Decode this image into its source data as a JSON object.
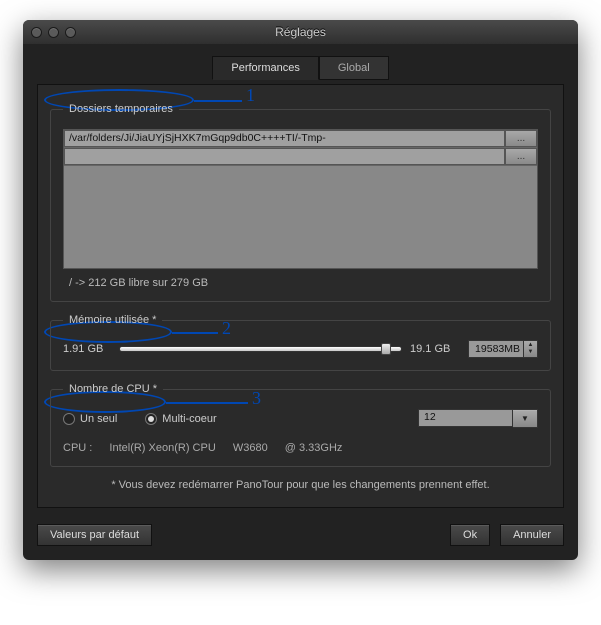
{
  "window": {
    "title": "Réglages"
  },
  "tabs": {
    "performances": "Performances",
    "global": "Global"
  },
  "folders": {
    "legend": "Dossiers temporaires",
    "rows": [
      {
        "path": "/var/folders/Ji/JiaUYjSjHXK7mGqp9db0C++++TI/-Tmp-",
        "btn": "..."
      },
      {
        "path": "",
        "btn": "..."
      }
    ],
    "disk": "/ -> 212 GB libre sur 279 GB"
  },
  "memory": {
    "legend": "Mémoire utilisée *",
    "min": "1.91 GB",
    "max": "19.1 GB",
    "value": "19583MB"
  },
  "cpu": {
    "legend": "Nombre de CPU *",
    "single": "Un seul",
    "multi": "Multi-coeur",
    "selected": "12",
    "info_prefix": "CPU :",
    "info_model": "Intel(R) Xeon(R) CPU",
    "info_code": "W3680",
    "info_freq": "@ 3.33GHz"
  },
  "restart_note": "* Vous devez redémarrer PanoTour pour que les changements prennent effet.",
  "footer": {
    "defaults": "Valeurs par défaut",
    "ok": "Ok",
    "cancel": "Annuler"
  },
  "annotations": {
    "a1": "1",
    "a2": "2",
    "a3": "3"
  }
}
